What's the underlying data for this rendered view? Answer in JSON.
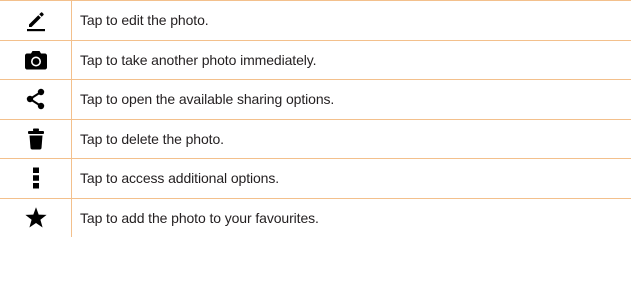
{
  "rows": [
    {
      "icon": "edit-pencil-icon",
      "text": "Tap to edit the photo."
    },
    {
      "icon": "camera-icon",
      "text": "Tap to take another photo immediately."
    },
    {
      "icon": "share-icon",
      "text": "Tap to open the available sharing options."
    },
    {
      "icon": "trash-icon",
      "text": "Tap to delete the photo."
    },
    {
      "icon": "more-vertical-icon",
      "text": "Tap to access additional options."
    },
    {
      "icon": "star-icon",
      "text": "Tap to add the photo to your favourites."
    }
  ],
  "colors": {
    "border": "#f3c08c",
    "text": "#231f20",
    "icon": "#000000"
  }
}
